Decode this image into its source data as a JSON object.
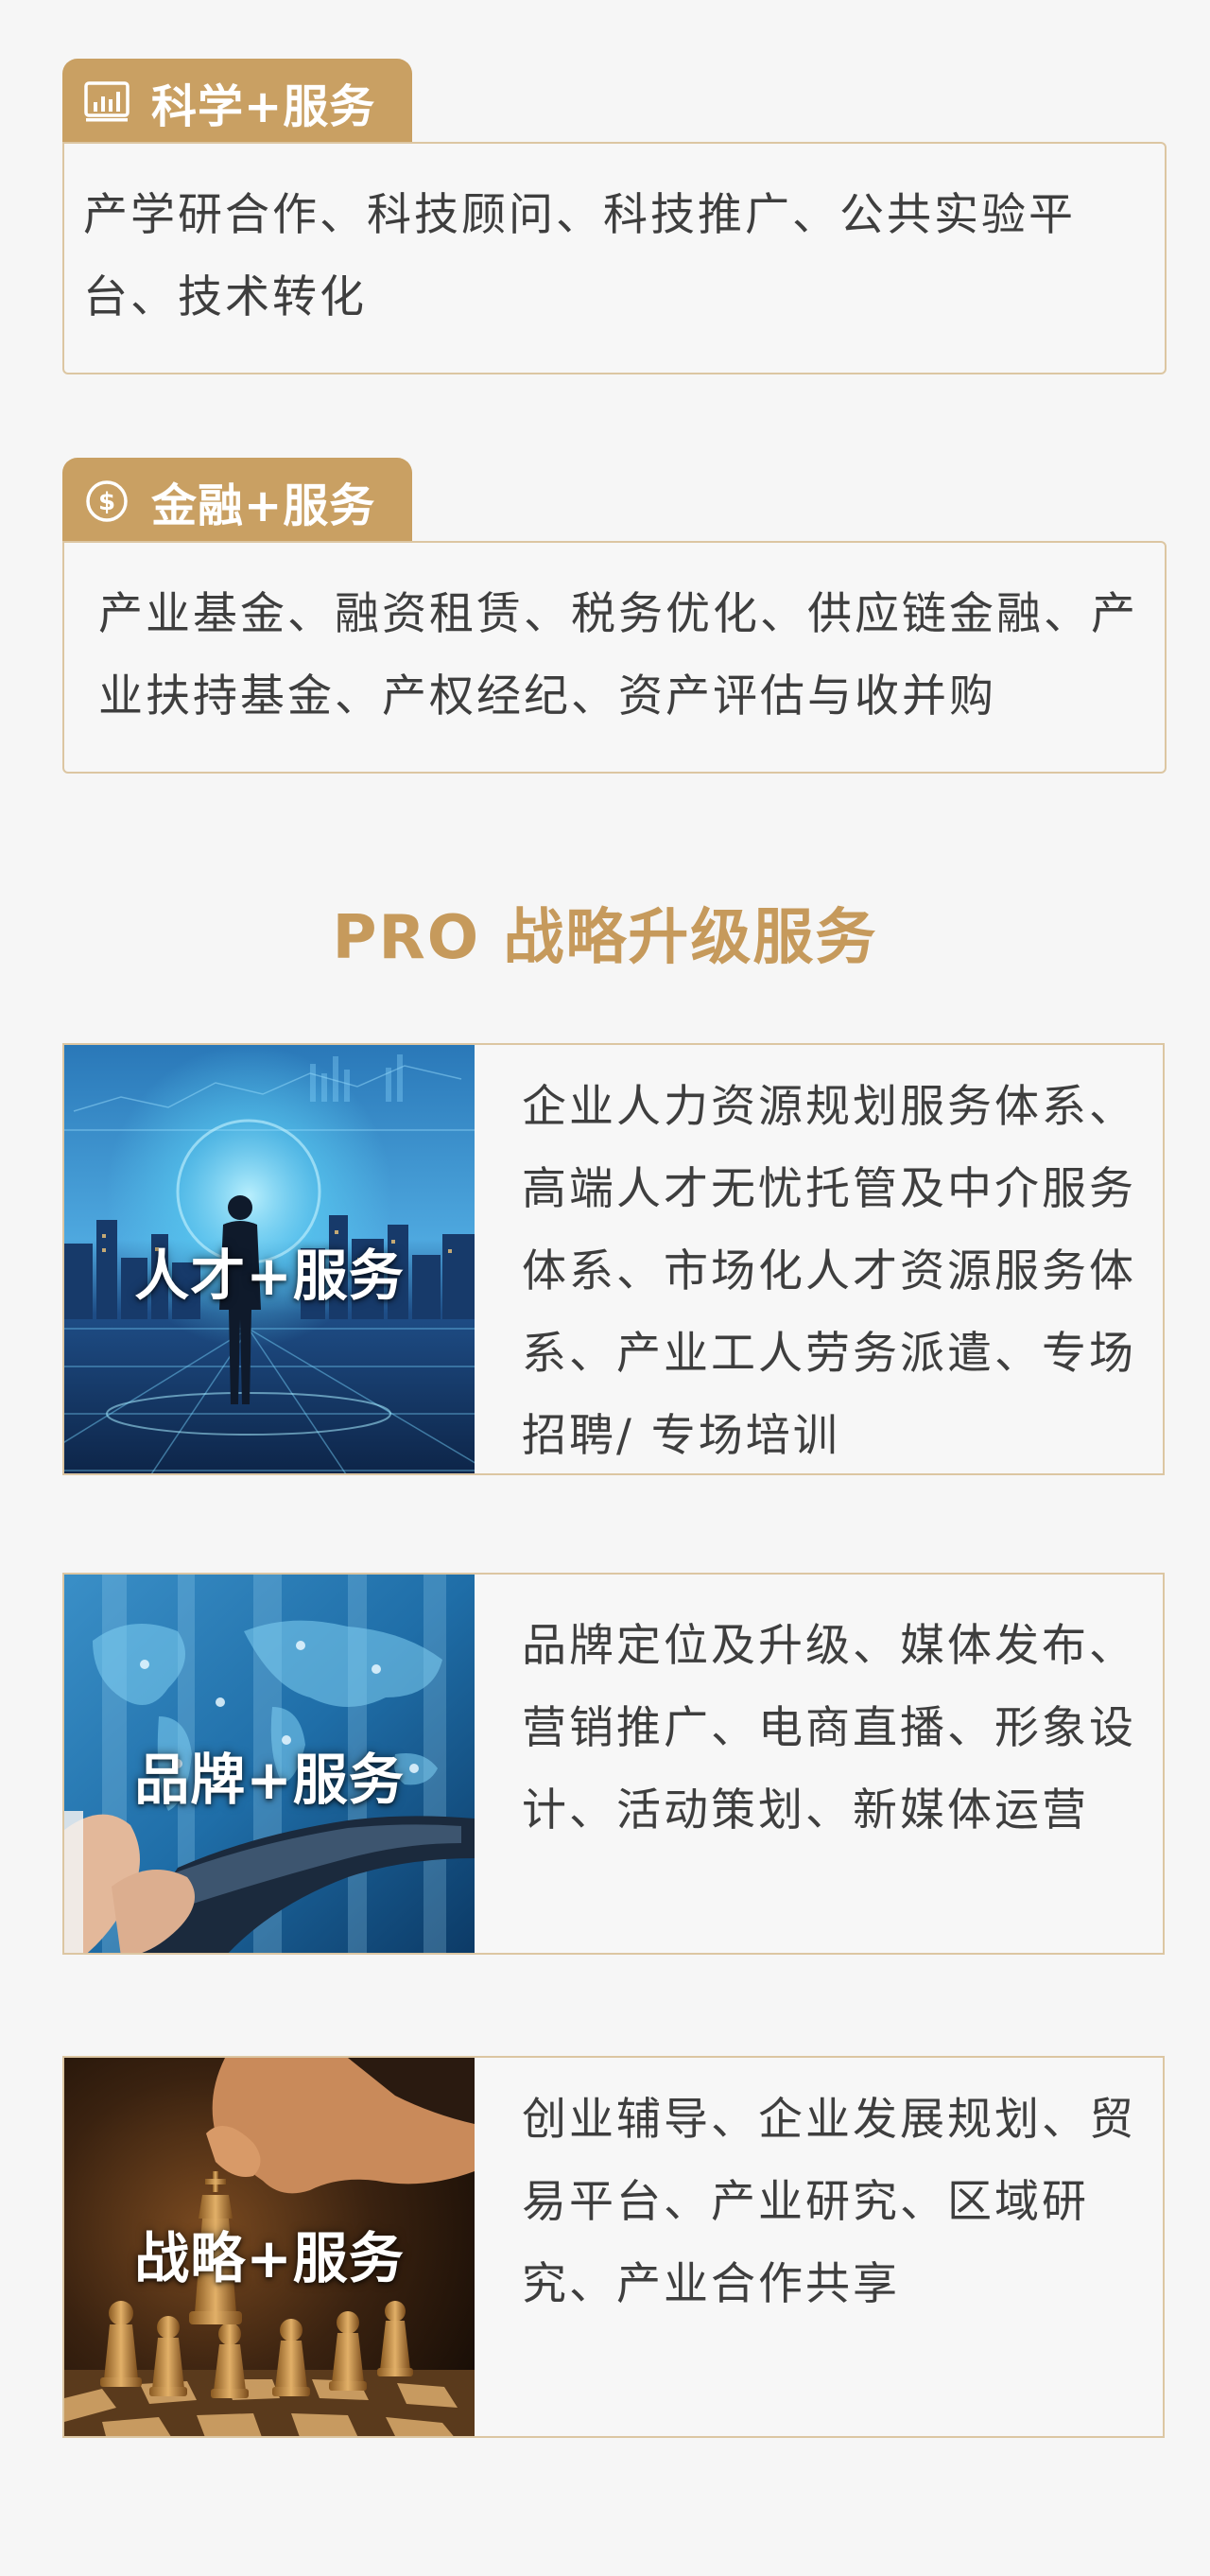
{
  "top_services": [
    {
      "label": "科学+服务",
      "icon": "bar-chart-icon",
      "text": "产学研合作、科技顾问、科技推广、公共实验平台、技术转化"
    },
    {
      "label": "金融+服务",
      "icon": "dollar-coin-icon",
      "text": "产业基金、融资租赁、税务优化、供应链金融、产业扶持基金、产权经纪、资产评估与收并购"
    }
  ],
  "section_title": "PRO 战略升级服务",
  "pro_services": [
    {
      "label": "人才+服务",
      "image": "businessman-city-image",
      "text": "企业人力资源规划服务体系、高端人才无忧托管及中介服务体系、市场化人才资源服务体系、产业工人劳务派遣、专场招聘/ 专场培训"
    },
    {
      "label": "品牌+服务",
      "image": "world-map-tablet-image",
      "text": "品牌定位及升级、媒体发布、营销推广、电商直播、形象设计、活动策划、新媒体运营"
    },
    {
      "label": "战略+服务",
      "image": "chess-pieces-image",
      "text": "创业辅导、企业发展规划、贸易平台、产业研究、区域研究、产业合作共享"
    }
  ],
  "colors": {
    "accent_gold": "#c9a063",
    "border_gold": "#dcc6a2",
    "body_text": "#3e3e3e",
    "background": "#f6f6f6"
  }
}
